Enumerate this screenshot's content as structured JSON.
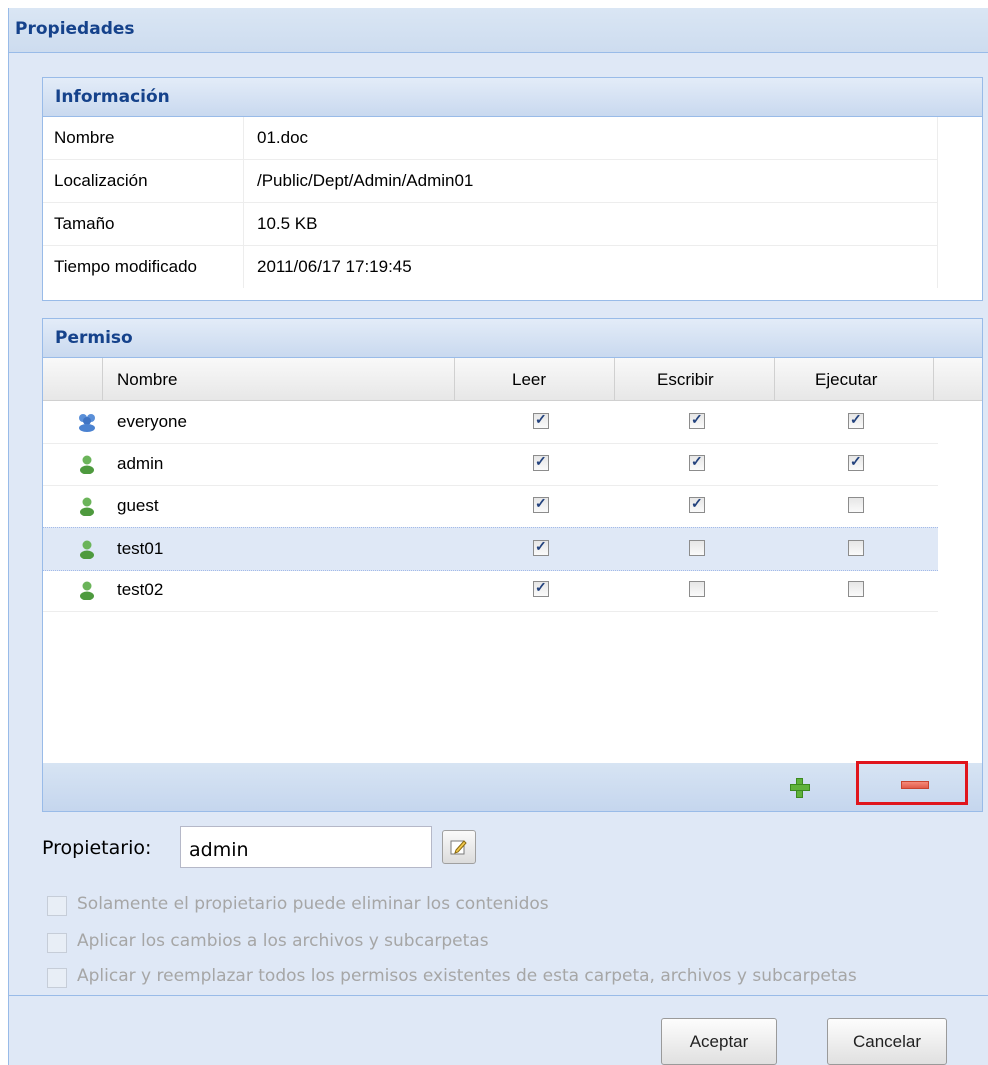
{
  "window": {
    "title": "Propiedades"
  },
  "info": {
    "title": "Información",
    "rows": [
      {
        "key": "Nombre",
        "value": "01.doc"
      },
      {
        "key": "Localización",
        "value": "/Public/Dept/Admin/Admin01"
      },
      {
        "key": "Tamaño",
        "value": "10.5 KB"
      },
      {
        "key": "Tiempo modificado",
        "value": "2011/06/17 17:19:45"
      }
    ]
  },
  "permissions": {
    "title": "Permiso",
    "columns": {
      "name": "Nombre",
      "read": "Leer",
      "write": "Escribir",
      "execute": "Ejecutar"
    },
    "rows": [
      {
        "name": "everyone",
        "icon": "group-icon",
        "read": true,
        "write": true,
        "execute": true,
        "selected": false
      },
      {
        "name": "admin",
        "icon": "user-icon",
        "read": true,
        "write": true,
        "execute": true,
        "selected": false
      },
      {
        "name": "guest",
        "icon": "user-icon",
        "read": true,
        "write": true,
        "execute": false,
        "selected": false
      },
      {
        "name": "test01",
        "icon": "user-icon",
        "read": true,
        "write": false,
        "execute": false,
        "selected": true
      },
      {
        "name": "test02",
        "icon": "user-icon",
        "read": true,
        "write": false,
        "execute": false,
        "selected": false
      }
    ],
    "toolbar": {
      "add_icon": "plus-icon",
      "remove_icon": "minus-icon"
    }
  },
  "owner": {
    "label": "Propietario:",
    "value": "admin",
    "edit_icon": "pencil-edit-icon"
  },
  "options": [
    {
      "label": "Solamente el propietario puede eliminar los contenidos",
      "checked": false
    },
    {
      "label": "Aplicar los cambios a los archivos y subcarpetas",
      "checked": false
    },
    {
      "label": "Aplicar y reemplazar todos los permisos existentes de esta carpeta, archivos y subcarpetas",
      "checked": false
    }
  ],
  "buttons": {
    "ok": "Aceptar",
    "cancel": "Cancelar"
  },
  "colors": {
    "header_text": "#15428b",
    "panel_border": "#99bbe8",
    "highlight": "#e0151c"
  }
}
